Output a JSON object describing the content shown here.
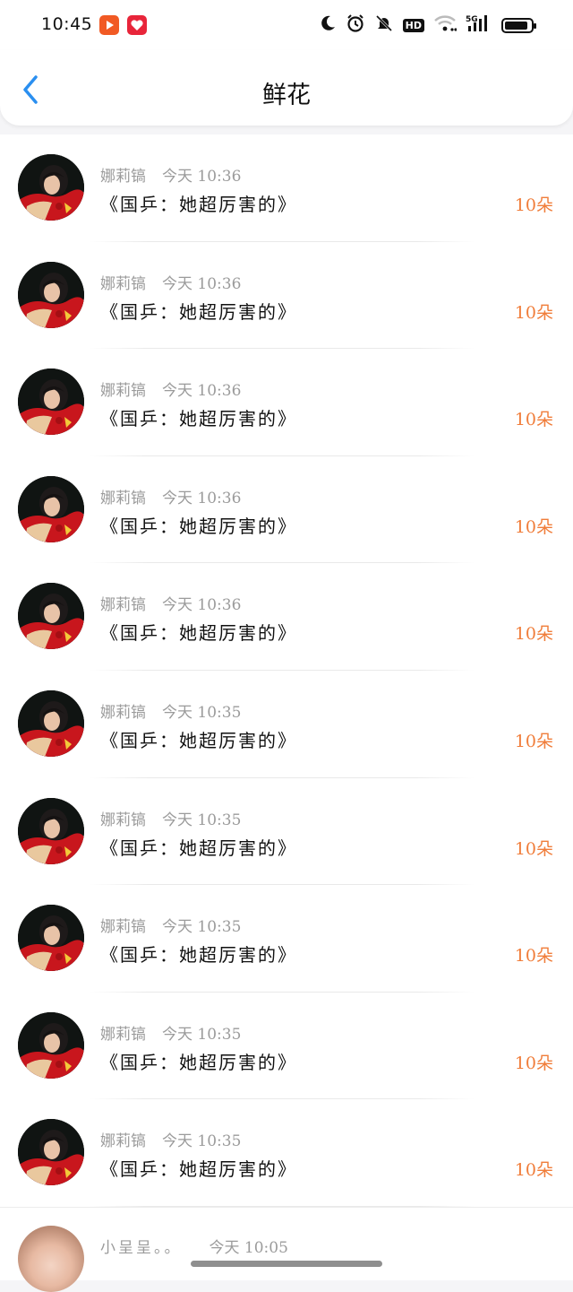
{
  "status_bar": {
    "time": "10:45",
    "icons": [
      "video-app-icon",
      "heart-app-icon",
      "moon-icon",
      "alarm-icon",
      "mute-icon",
      "hd-badge",
      "wifi-icon",
      "signal-5g-icon",
      "battery-icon"
    ],
    "hd_label": "HD",
    "network_label": "5G",
    "battery_level": 0.9
  },
  "nav": {
    "back_icon": "chevron-left-icon",
    "title": "鲜花",
    "accent_color": "#2a8ff0"
  },
  "items": [
    {
      "user": "娜莉镐",
      "time": "今天 10:36",
      "title": "《国乒：她超厉害的》",
      "count": "10朵"
    },
    {
      "user": "娜莉镐",
      "time": "今天 10:36",
      "title": "《国乒：她超厉害的》",
      "count": "10朵"
    },
    {
      "user": "娜莉镐",
      "time": "今天 10:36",
      "title": "《国乒：她超厉害的》",
      "count": "10朵"
    },
    {
      "user": "娜莉镐",
      "time": "今天 10:36",
      "title": "《国乒：她超厉害的》",
      "count": "10朵"
    },
    {
      "user": "娜莉镐",
      "time": "今天 10:36",
      "title": "《国乒：她超厉害的》",
      "count": "10朵"
    },
    {
      "user": "娜莉镐",
      "time": "今天 10:35",
      "title": "《国乒：她超厉害的》",
      "count": "10朵"
    },
    {
      "user": "娜莉镐",
      "time": "今天 10:35",
      "title": "《国乒：她超厉害的》",
      "count": "10朵"
    },
    {
      "user": "娜莉镐",
      "time": "今天 10:35",
      "title": "《国乒：她超厉害的》",
      "count": "10朵"
    },
    {
      "user": "娜莉镐",
      "time": "今天 10:35",
      "title": "《国乒：她超厉害的》",
      "count": "10朵"
    },
    {
      "user": "娜莉镐",
      "time": "今天 10:35",
      "title": "《国乒：她超厉害的》",
      "count": "10朵"
    }
  ],
  "partial_item": {
    "user": "小呈呈。。",
    "time": "今天 10:05"
  },
  "colors": {
    "count_color": "#f07d3a",
    "meta_color": "#9b9b9b"
  }
}
